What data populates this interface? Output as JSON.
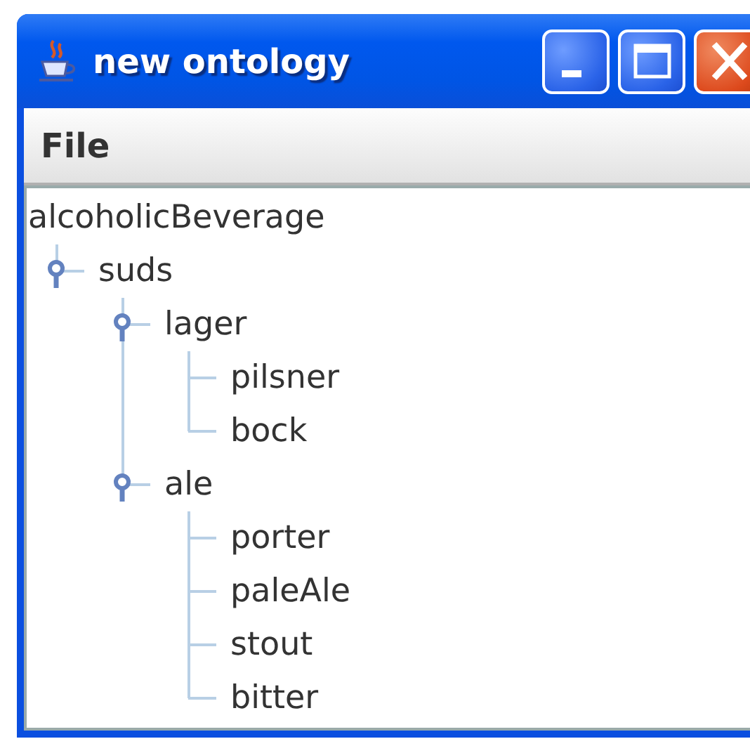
{
  "window": {
    "title": "new ontology"
  },
  "menu": [
    "File"
  ],
  "tree": {
    "label": "alcoholicBeverage",
    "children": [
      {
        "label": "suds",
        "expanded": true,
        "children": [
          {
            "label": "lager",
            "expanded": true,
            "children": [
              {
                "label": "pilsner"
              },
              {
                "label": "bock"
              }
            ]
          },
          {
            "label": "ale",
            "expanded": true,
            "children": [
              {
                "label": "porter"
              },
              {
                "label": "paleAle"
              },
              {
                "label": "stout"
              },
              {
                "label": "bitter"
              }
            ]
          }
        ]
      }
    ]
  }
}
